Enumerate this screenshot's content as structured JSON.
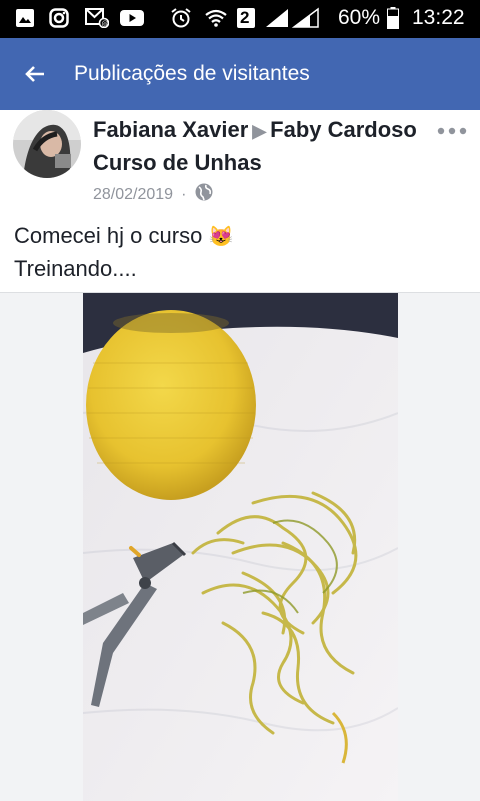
{
  "status_bar": {
    "battery": "60%",
    "time": "13:22",
    "sim_slot": "2",
    "icons": [
      "gallery-icon",
      "instagram-icon",
      "outlook-icon",
      "youtube-icon",
      "alarm-icon",
      "wifi-icon",
      "sim-2-icon",
      "signal-icon",
      "battery-icon"
    ]
  },
  "appbar": {
    "title": "Publicações de visitantes",
    "back_icon": "back-arrow-icon"
  },
  "post": {
    "author": "Fabiana Xavier",
    "target": "Faby Cardoso Curso de Unhas",
    "date": "28/02/2019",
    "dot": "·",
    "privacy_icon": "globe-icon",
    "more_icon": "more-options-icon",
    "text_line1": "Comecei hj o curso",
    "emoji": "😻",
    "text_line2": "Treinando...."
  },
  "colors": {
    "appbar": "#4267b2",
    "status_bar": "#000000",
    "text": "#1d2129",
    "meta": "#90949c"
  }
}
